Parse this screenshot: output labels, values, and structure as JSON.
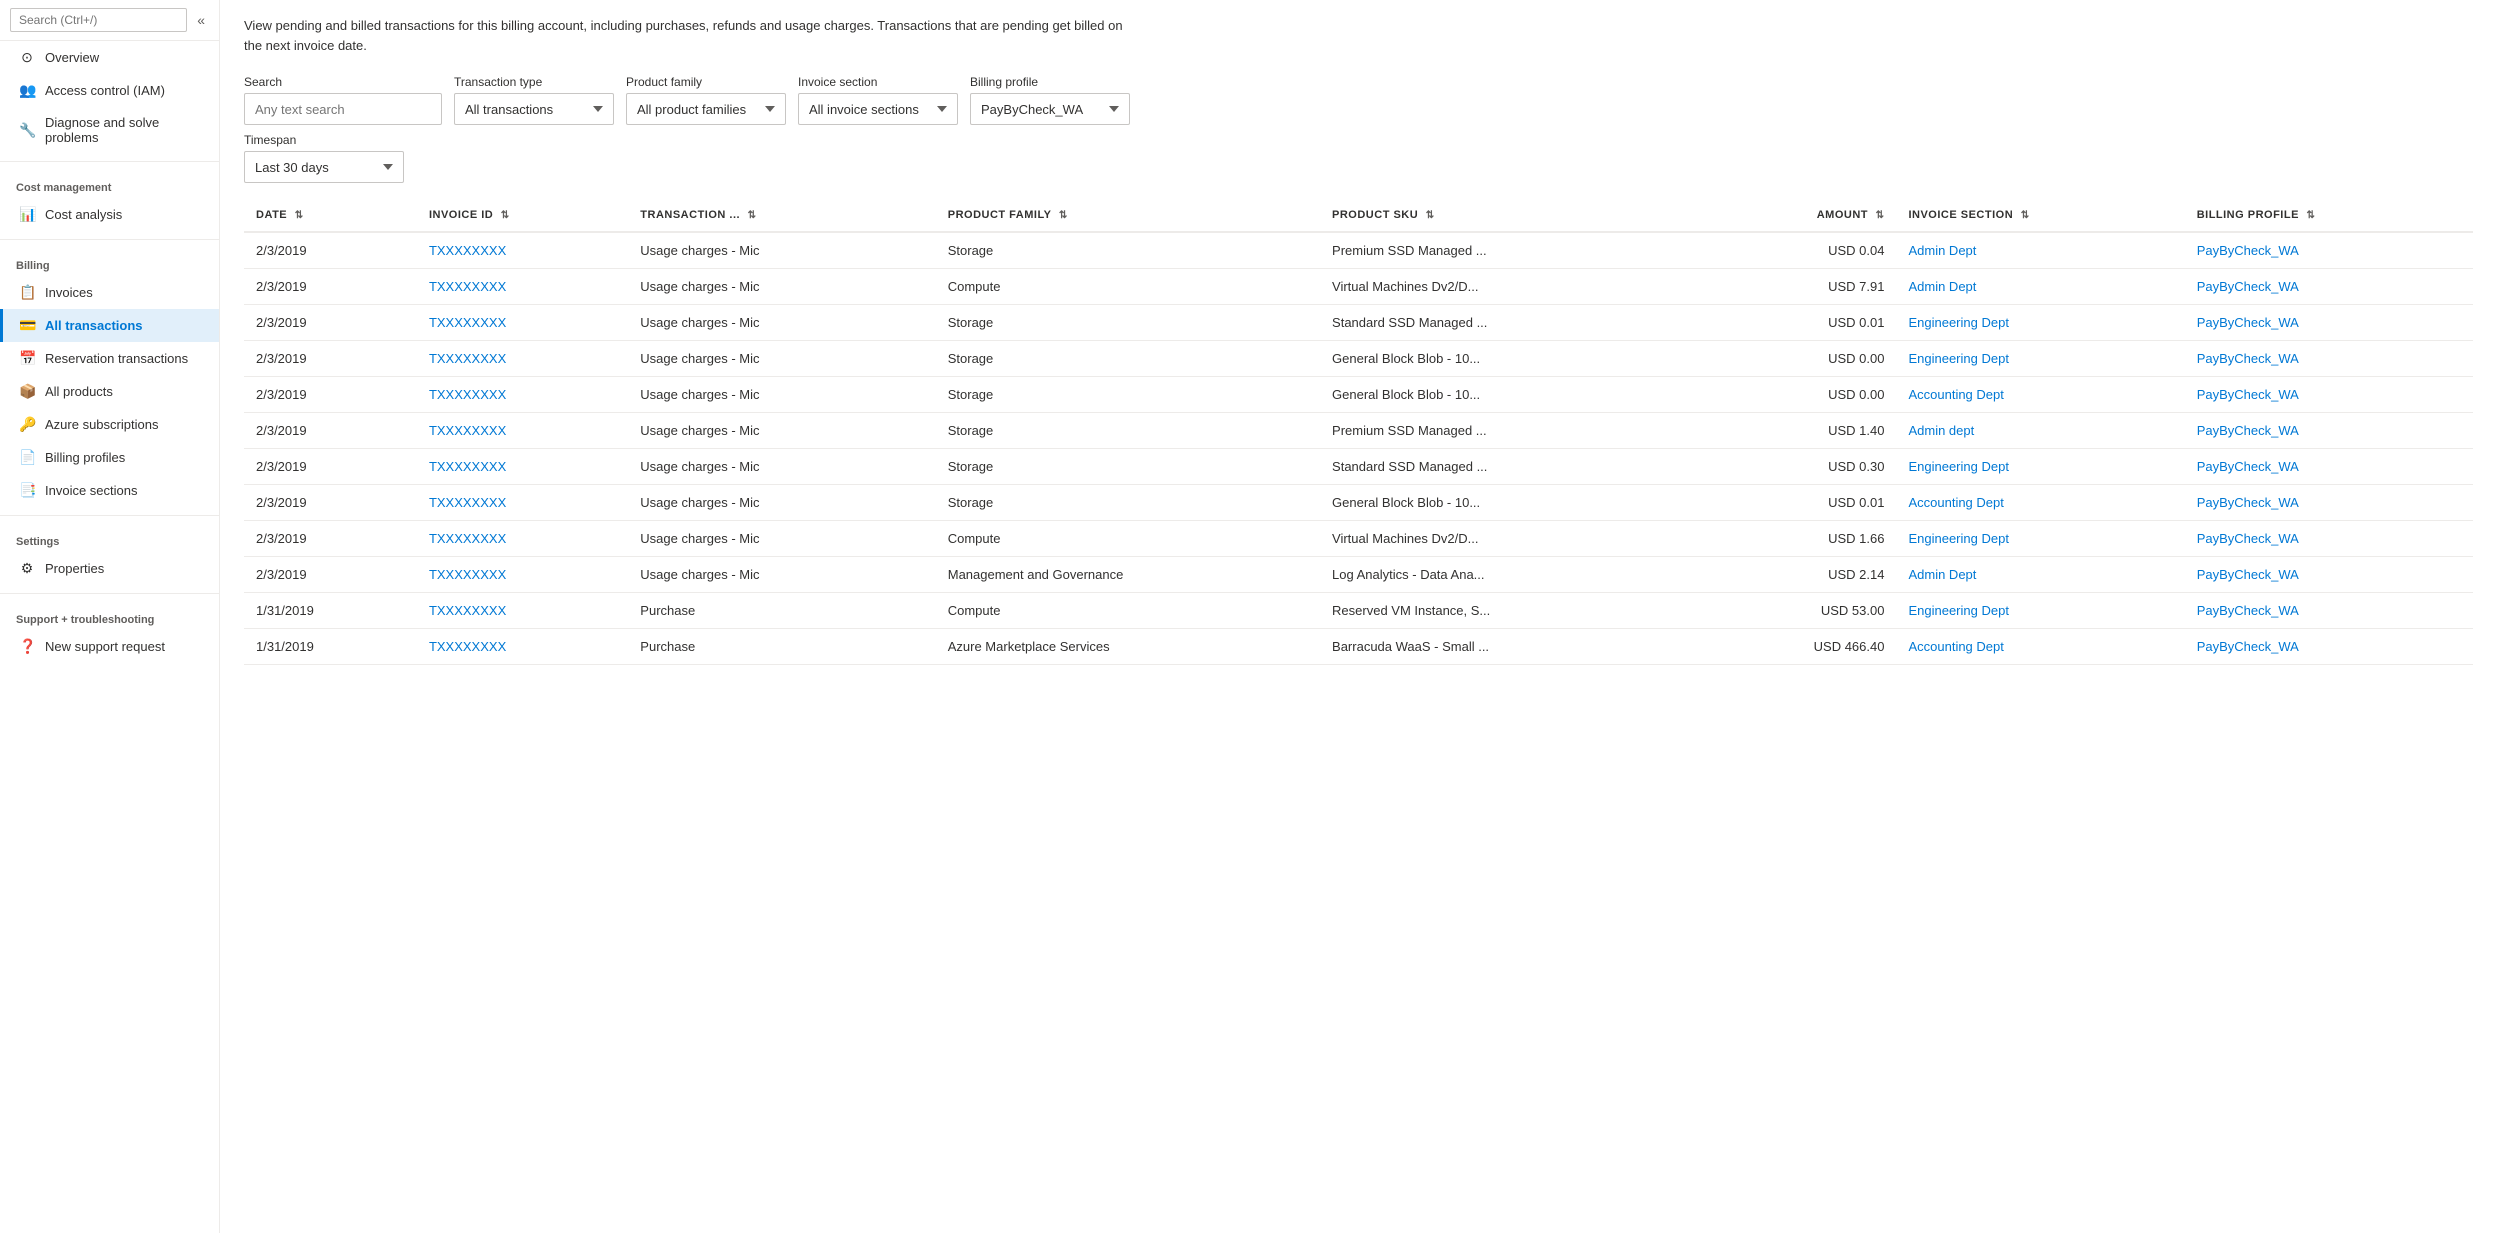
{
  "sidebar": {
    "search_placeholder": "Search (Ctrl+/)",
    "items": [
      {
        "id": "overview",
        "label": "Overview",
        "icon": "⊙",
        "section": null,
        "active": false
      },
      {
        "id": "access-control",
        "label": "Access control (IAM)",
        "icon": "👥",
        "section": null,
        "active": false
      },
      {
        "id": "diagnose",
        "label": "Diagnose and solve problems",
        "icon": "🔧",
        "section": null,
        "active": false
      },
      {
        "id": "cost-management-header",
        "label": "Cost management",
        "type": "section"
      },
      {
        "id": "cost-analysis",
        "label": "Cost analysis",
        "icon": "📊",
        "section": "cost-management",
        "active": false
      },
      {
        "id": "billing-header",
        "label": "Billing",
        "type": "section"
      },
      {
        "id": "invoices",
        "label": "Invoices",
        "icon": "📋",
        "section": "billing",
        "active": false
      },
      {
        "id": "all-transactions",
        "label": "All transactions",
        "icon": "💳",
        "section": "billing",
        "active": true
      },
      {
        "id": "reservation-transactions",
        "label": "Reservation transactions",
        "icon": "📅",
        "section": "billing",
        "active": false
      },
      {
        "id": "all-products",
        "label": "All products",
        "icon": "📦",
        "section": "billing",
        "active": false
      },
      {
        "id": "azure-subscriptions",
        "label": "Azure subscriptions",
        "icon": "🔑",
        "section": "billing",
        "active": false
      },
      {
        "id": "billing-profiles",
        "label": "Billing profiles",
        "icon": "📄",
        "section": "billing",
        "active": false
      },
      {
        "id": "invoice-sections",
        "label": "Invoice sections",
        "icon": "📑",
        "section": "billing",
        "active": false
      },
      {
        "id": "settings-header",
        "label": "Settings",
        "type": "section"
      },
      {
        "id": "properties",
        "label": "Properties",
        "icon": "⚙",
        "section": "settings",
        "active": false
      },
      {
        "id": "support-header",
        "label": "Support + troubleshooting",
        "type": "section"
      },
      {
        "id": "new-support-request",
        "label": "New support request",
        "icon": "❓",
        "section": "support",
        "active": false
      }
    ]
  },
  "main": {
    "description": "View pending and billed transactions for this billing account, including purchases, refunds and usage charges. Transactions that are pending get billed on the next invoice date.",
    "filters": {
      "search_label": "Search",
      "search_placeholder": "Any text search",
      "transaction_type_label": "Transaction type",
      "transaction_type_value": "All transactions",
      "product_family_label": "Product family",
      "product_family_value": "All product families",
      "invoice_section_label": "Invoice section",
      "invoice_section_value": "All invoice sections",
      "billing_profile_label": "Billing profile",
      "billing_profile_value": "PayByCheck_WA",
      "timespan_label": "Timespan",
      "timespan_value": "Last 30 days"
    },
    "table": {
      "columns": [
        "DATE",
        "INVOICE ID",
        "TRANSACTION ...",
        "PRODUCT FAMILY",
        "PRODUCT SKU",
        "AMOUNT",
        "INVOICE SECTION",
        "BILLING PROFILE"
      ],
      "rows": [
        {
          "date": "2/3/2019",
          "invoice_id": "TXXXXXXXX",
          "transaction": "Usage charges - Mic",
          "product_family": "Storage",
          "product_sku": "Premium SSD Managed ...",
          "amount": "USD 0.04",
          "invoice_section": "Admin Dept",
          "billing_profile": "PayByCheck_WA"
        },
        {
          "date": "2/3/2019",
          "invoice_id": "TXXXXXXXX",
          "transaction": "Usage charges - Mic",
          "product_family": "Compute",
          "product_sku": "Virtual Machines Dv2/D...",
          "amount": "USD 7.91",
          "invoice_section": "Admin Dept",
          "billing_profile": "PayByCheck_WA"
        },
        {
          "date": "2/3/2019",
          "invoice_id": "TXXXXXXXX",
          "transaction": "Usage charges - Mic",
          "product_family": "Storage",
          "product_sku": "Standard SSD Managed ...",
          "amount": "USD 0.01",
          "invoice_section": "Engineering Dept",
          "billing_profile": "PayByCheck_WA"
        },
        {
          "date": "2/3/2019",
          "invoice_id": "TXXXXXXXX",
          "transaction": "Usage charges - Mic",
          "product_family": "Storage",
          "product_sku": "General Block Blob - 10...",
          "amount": "USD 0.00",
          "invoice_section": "Engineering Dept",
          "billing_profile": "PayByCheck_WA"
        },
        {
          "date": "2/3/2019",
          "invoice_id": "TXXXXXXXX",
          "transaction": "Usage charges - Mic",
          "product_family": "Storage",
          "product_sku": "General Block Blob - 10...",
          "amount": "USD 0.00",
          "invoice_section": "Accounting Dept",
          "billing_profile": "PayByCheck_WA"
        },
        {
          "date": "2/3/2019",
          "invoice_id": "TXXXXXXXX",
          "transaction": "Usage charges - Mic",
          "product_family": "Storage",
          "product_sku": "Premium SSD Managed ...",
          "amount": "USD 1.40",
          "invoice_section": "Admin dept",
          "billing_profile": "PayByCheck_WA"
        },
        {
          "date": "2/3/2019",
          "invoice_id": "TXXXXXXXX",
          "transaction": "Usage charges - Mic",
          "product_family": "Storage",
          "product_sku": "Standard SSD Managed ...",
          "amount": "USD 0.30",
          "invoice_section": "Engineering Dept",
          "billing_profile": "PayByCheck_WA"
        },
        {
          "date": "2/3/2019",
          "invoice_id": "TXXXXXXXX",
          "transaction": "Usage charges - Mic",
          "product_family": "Storage",
          "product_sku": "General Block Blob - 10...",
          "amount": "USD 0.01",
          "invoice_section": "Accounting Dept",
          "billing_profile": "PayByCheck_WA"
        },
        {
          "date": "2/3/2019",
          "invoice_id": "TXXXXXXXX",
          "transaction": "Usage charges - Mic",
          "product_family": "Compute",
          "product_sku": "Virtual Machines Dv2/D...",
          "amount": "USD 1.66",
          "invoice_section": "Engineering Dept",
          "billing_profile": "PayByCheck_WA"
        },
        {
          "date": "2/3/2019",
          "invoice_id": "TXXXXXXXX",
          "transaction": "Usage charges - Mic",
          "product_family": "Management and Governance",
          "product_sku": "Log Analytics - Data Ana...",
          "amount": "USD 2.14",
          "invoice_section": "Admin Dept",
          "billing_profile": "PayByCheck_WA"
        },
        {
          "date": "1/31/2019",
          "invoice_id": "TXXXXXXXX",
          "transaction": "Purchase",
          "product_family": "Compute",
          "product_sku": "Reserved VM Instance, S...",
          "amount": "USD 53.00",
          "invoice_section": "Engineering Dept",
          "billing_profile": "PayByCheck_WA"
        },
        {
          "date": "1/31/2019",
          "invoice_id": "TXXXXXXXX",
          "transaction": "Purchase",
          "product_family": "Azure Marketplace Services",
          "product_sku": "Barracuda WaaS - Small ...",
          "amount": "USD 466.40",
          "invoice_section": "Accounting Dept",
          "billing_profile": "PayByCheck_WA"
        }
      ]
    }
  }
}
